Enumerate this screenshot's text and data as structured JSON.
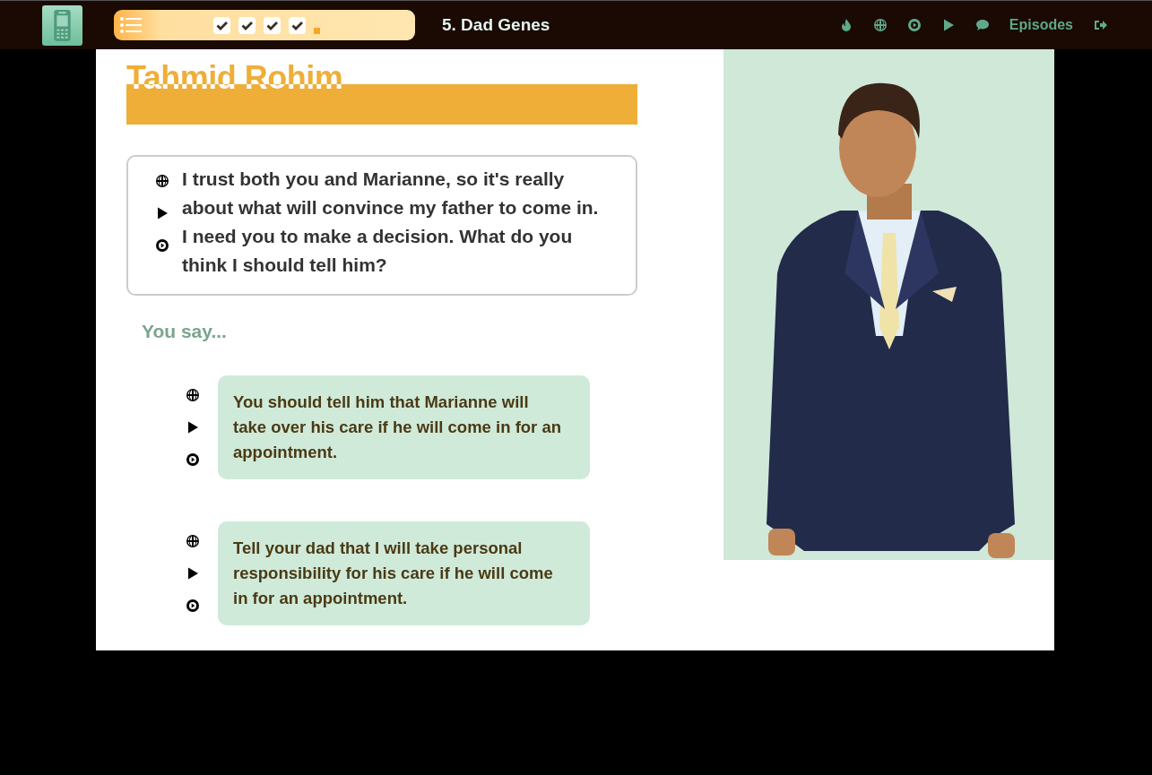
{
  "top_bar": {
    "progress": [
      {
        "checked": true
      },
      {
        "checked": true
      },
      {
        "checked": true
      },
      {
        "checked": true
      },
      {
        "checked": false
      }
    ],
    "episode_title": "5. Dad Genes",
    "nav": [
      {
        "kind": "flame"
      },
      {
        "kind": "globe"
      },
      {
        "kind": "play-circle"
      },
      {
        "kind": "play"
      },
      {
        "kind": "comment"
      },
      {
        "kind": "link",
        "label": "Episodes"
      },
      {
        "kind": "exit"
      }
    ]
  },
  "speaker": {
    "name": "Tahmid Rohim",
    "line": "I trust both you and Marianne, so it's really about what will convince my father to come in. I need you to make a decision. What do you think I should tell him?"
  },
  "prompt": "You say...",
  "responses": [
    {
      "text": "You should tell him that Marianne will take over his care if he will come in for an appointment."
    },
    {
      "text": "Tell your dad that I will take personal responsibility for his care if he will come in for an appointment."
    }
  ]
}
